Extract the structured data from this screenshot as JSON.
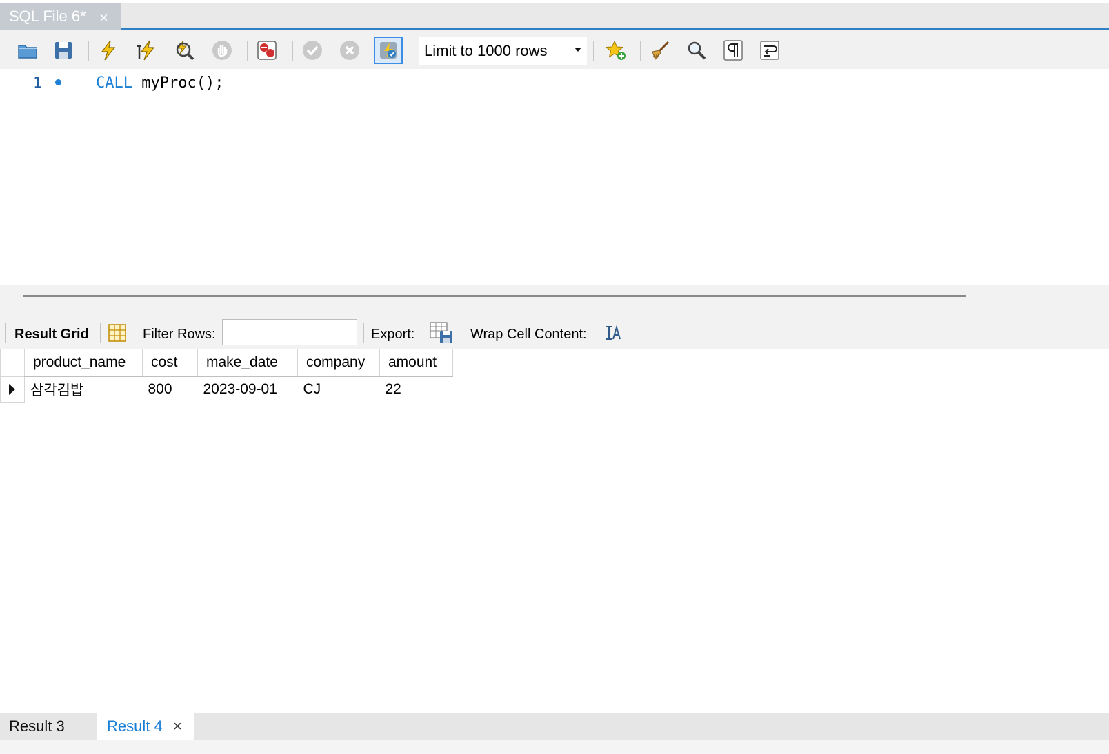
{
  "editor_tab": {
    "label": "SQL File 6*",
    "close": "×"
  },
  "toolbar": {
    "limit_select": {
      "value": "Limit to 1000 rows"
    },
    "buttons": [
      "open-file-icon",
      "save-icon",
      "execute-icon",
      "execute-current-icon",
      "explain-icon",
      "stop-icon",
      "toggle-stop-on-error-icon",
      "commit-icon",
      "rollback-icon",
      "autocommit-icon",
      "add-snippet-icon",
      "beautify-icon",
      "find-icon",
      "invisible-chars-icon",
      "wrap-lines-icon"
    ]
  },
  "editor": {
    "line_number": "1",
    "keyword": "CALL",
    "rest": " myProc();"
  },
  "result_toolbar": {
    "result_grid_label": "Result Grid",
    "filter_label": "Filter Rows:",
    "filter_value": "",
    "export_label": "Export:",
    "wrap_label": "Wrap Cell Content:"
  },
  "grid": {
    "columns": [
      "product_name",
      "cost",
      "make_date",
      "company",
      "amount"
    ],
    "rows": [
      [
        "삼각김밥",
        "800",
        "2023-09-01",
        "CJ",
        "22"
      ]
    ]
  },
  "result_tabs": [
    {
      "label": "Result 3",
      "active": false
    },
    {
      "label": "Result 4",
      "active": true,
      "close": "×"
    }
  ],
  "colors": {
    "accent": "#2f7fc4",
    "keyword": "#1c7fd6",
    "active_tab_text": "#1c7fd6"
  }
}
